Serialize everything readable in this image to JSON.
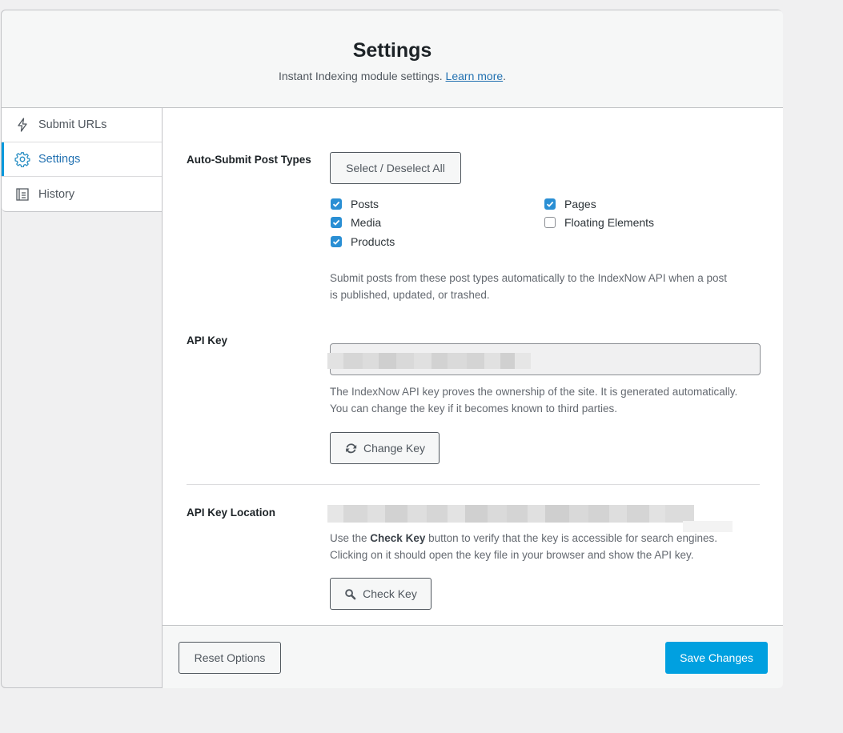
{
  "header": {
    "title": "Settings",
    "description": "Instant Indexing module settings.",
    "learn_more": "Learn more",
    "period": "."
  },
  "tabs": [
    {
      "label": "Submit URLs",
      "icon": "bolt-icon",
      "active": false
    },
    {
      "label": "Settings",
      "icon": "gear-icon",
      "active": true
    },
    {
      "label": "History",
      "icon": "document-icon",
      "active": false
    }
  ],
  "post_types": {
    "label": "Auto-Submit Post Types",
    "select_all_label": "Select / Deselect All",
    "options": [
      {
        "label": "Posts",
        "checked": true
      },
      {
        "label": "Pages",
        "checked": true
      },
      {
        "label": "Media",
        "checked": true
      },
      {
        "label": "Floating Elements",
        "checked": false
      },
      {
        "label": "Products",
        "checked": true
      }
    ],
    "help_line1": "Submit posts from these post types automatically to the IndexNow API when a post",
    "help_line2": "is published, updated, or trashed."
  },
  "api_key": {
    "label": "API Key",
    "value": "",
    "help_line1": "The IndexNow API key proves the ownership of the site. It is generated automatically.",
    "help_line2": "You can change the key if it becomes known to third parties.",
    "change_key_label": "Change Key"
  },
  "api_key_location": {
    "label": "API Key Location",
    "help_prefix": "Use the",
    "help_bold": "Check Key",
    "help_suffix": "button to verify that the key is accessible for search engines.",
    "help_line2": "Clicking on it should open the key file in your browser and show the API key.",
    "check_key_label": "Check Key"
  },
  "footer": {
    "reset_label": "Reset Options",
    "save_label": "Save Changes"
  },
  "colors": {
    "accent": "#00a0e0",
    "checkbox": "#2a8fd4",
    "link": "#2271b1"
  }
}
